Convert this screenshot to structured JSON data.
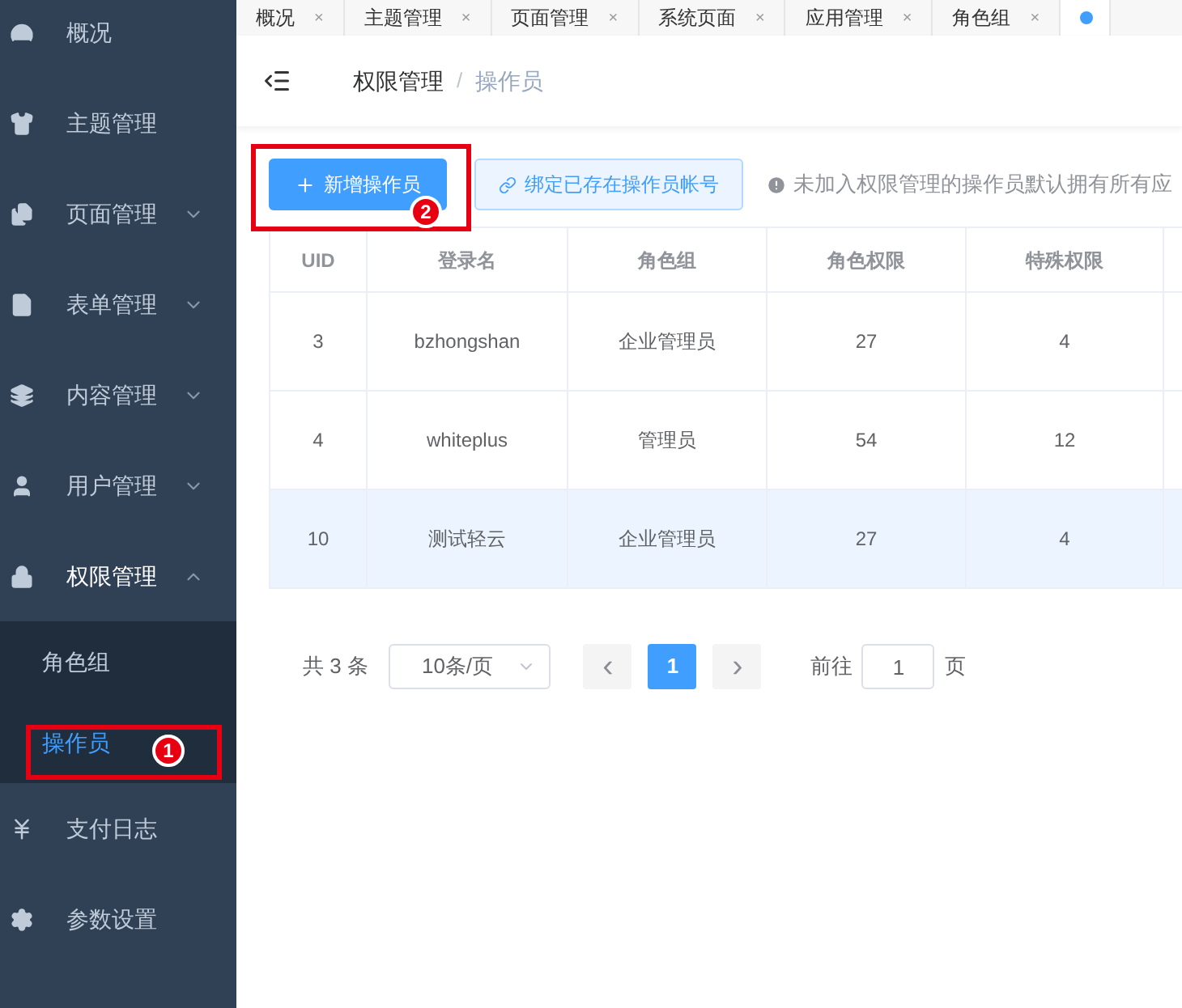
{
  "sidebar": {
    "items": [
      {
        "label": "概况",
        "expanded": false,
        "caret": false
      },
      {
        "label": "主题管理",
        "expanded": false,
        "caret": false
      },
      {
        "label": "页面管理",
        "expanded": false,
        "caret": true
      },
      {
        "label": "表单管理",
        "expanded": false,
        "caret": true
      },
      {
        "label": "内容管理",
        "expanded": false,
        "caret": true
      },
      {
        "label": "用户管理",
        "expanded": false,
        "caret": true
      },
      {
        "label": "权限管理",
        "expanded": true,
        "caret": true,
        "children": [
          {
            "label": "角色组",
            "selected": false
          },
          {
            "label": "操作员",
            "selected": true,
            "callout": "1"
          }
        ]
      },
      {
        "label": "支付日志",
        "expanded": false,
        "caret": false
      },
      {
        "label": "参数设置",
        "expanded": false,
        "caret": false
      }
    ]
  },
  "tabs": [
    {
      "label": "概况",
      "close": "×",
      "selected": false
    },
    {
      "label": "主题管理",
      "close": "×",
      "selected": false
    },
    {
      "label": "页面管理",
      "close": "×",
      "selected": false
    },
    {
      "label": "系统页面",
      "close": "×",
      "selected": false
    },
    {
      "label": "应用管理",
      "close": "×",
      "selected": false
    },
    {
      "label": "角色组",
      "close": "×",
      "selected": false
    },
    {
      "selected": true
    }
  ],
  "breadcrumb": [
    "权限管理",
    "操作员"
  ],
  "breadcrumb_separator": "/",
  "toolbar": {
    "primary_button": {
      "label": "新增操作员",
      "callout": "2"
    },
    "secondary_button": {
      "label": "绑定已存在操作员帐号"
    },
    "hint": "未加入权限管理的操作员默认拥有所有应"
  },
  "table": {
    "columns": [
      "UID",
      "登录名",
      "角色组",
      "角色权限",
      "特殊权限"
    ],
    "rows": [
      {
        "cells": [
          "3",
          "bzhongshan",
          "企业管理员",
          "27",
          "4"
        ],
        "selected": false
      },
      {
        "cells": [
          "4",
          "whiteplus",
          "管理员",
          "54",
          "12"
        ],
        "selected": false
      },
      {
        "cells": [
          "10",
          "测试轻云",
          "企业管理员",
          "27",
          "4"
        ],
        "selected": true
      }
    ]
  },
  "pagination": {
    "total": "共 3 条",
    "page_size": "10条/页",
    "prev": "‹",
    "pages": [
      {
        "label": "1",
        "selected": true
      }
    ],
    "next": "›",
    "goto_label": "前往",
    "goto_value": "1",
    "goto_suffix": "页"
  }
}
